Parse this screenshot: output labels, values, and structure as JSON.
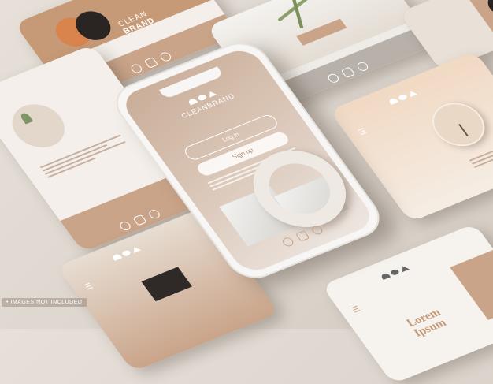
{
  "brand": {
    "name_top": "CLEAN",
    "name_bottom": "BRAND",
    "name_inline": "CLEANBRAND"
  },
  "phone": {
    "login_label": "Log in",
    "signup_label": "Sign up"
  },
  "card_bottom_right": {
    "headline_1": "Lorem",
    "headline_2": "Ipsum"
  },
  "watermark": {
    "text": "• IMAGES NOT INCLUDED"
  },
  "icons": [
    "instagram-icon",
    "twitter-icon",
    "facebook-icon",
    "hamburger-menu-icon",
    "logo-shapes-icon"
  ],
  "colors": {
    "background": "#e0d9d1",
    "accent_tan": "#c9a489",
    "accent_orange": "#d9844c",
    "screen_light": "#f4efea"
  }
}
